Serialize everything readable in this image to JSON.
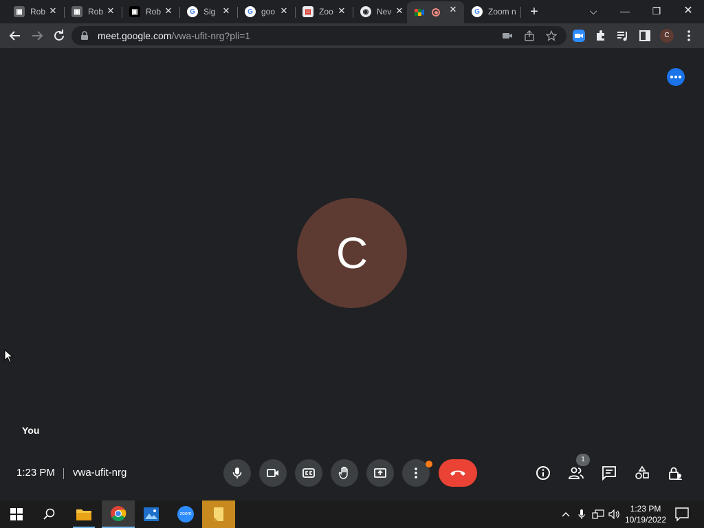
{
  "browser": {
    "tabs": [
      {
        "title": "Rob",
        "favicon": "roblox-icon",
        "active": false
      },
      {
        "title": "Rob",
        "favicon": "roblox-icon",
        "active": false
      },
      {
        "title": "Rob",
        "favicon": "roblox-dark-icon",
        "active": false
      },
      {
        "title": "Sig",
        "favicon": "google-icon",
        "active": false
      },
      {
        "title": "goo",
        "favicon": "google-icon",
        "active": false
      },
      {
        "title": "Zoo",
        "favicon": "zoom-icon",
        "active": false
      },
      {
        "title": "Nev",
        "favicon": "chrome-icon",
        "active": false
      },
      {
        "title": "",
        "favicon": "meet-icon",
        "active": true,
        "recording": true
      },
      {
        "title": "Zoom n",
        "favicon": "google-icon",
        "active": false
      }
    ],
    "new_tab": "+",
    "url_domain": "meet.google.com",
    "url_path": "/vwa-ufit-nrg?pli=1",
    "profile_initial": "C"
  },
  "meet": {
    "participant_initial": "C",
    "participant_name": "You",
    "time": "1:23 PM",
    "meeting_code": "vwa-ufit-nrg",
    "participant_count": "1"
  },
  "colors": {
    "avatar": "#5e3b32",
    "leave": "#ea4335",
    "accent": "#1a73e8",
    "badge": "#fa7b17"
  },
  "taskbar": {
    "clock_time": "1:23 PM",
    "clock_date": "10/19/2022",
    "zoom_label": "zoom"
  }
}
